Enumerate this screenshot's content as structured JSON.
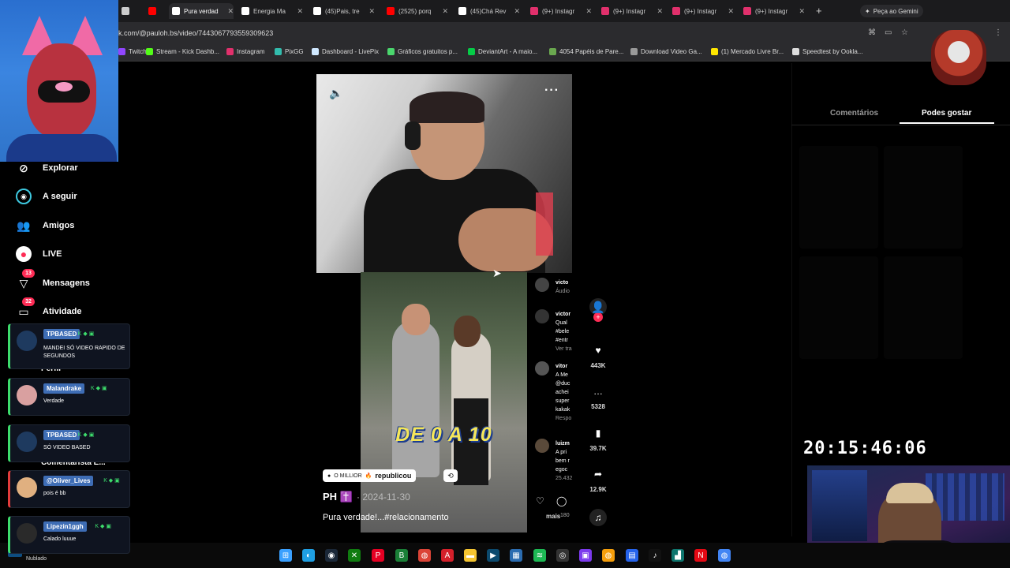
{
  "browser": {
    "tabs": [
      {
        "label": "",
        "color": "#cccccc",
        "active": false
      },
      {
        "label": "",
        "color": "#ff0000",
        "active": false
      },
      {
        "label": "Pura verdad",
        "color": "#ffffff",
        "active": true
      },
      {
        "label": "Energia Ma",
        "color": "#ffffff",
        "active": false
      },
      {
        "label": "(45)Pais, tre",
        "color": "#ffffff",
        "active": false
      },
      {
        "label": "(2525) porq",
        "color": "#ff0000",
        "active": false
      },
      {
        "label": "(45)Chá Rev",
        "color": "#ffffff",
        "active": false
      },
      {
        "label": "(9+) Instagr",
        "color": "#e1306c",
        "active": false
      },
      {
        "label": "(9+) Instagr",
        "color": "#e1306c",
        "active": false
      },
      {
        "label": "(9+) Instagr",
        "color": "#e1306c",
        "active": false
      },
      {
        "label": "(9+) Instagr",
        "color": "#e1306c",
        "active": false
      }
    ],
    "new_tab_glyph": "+",
    "gemini_label": "Peça ao Gemini",
    "url": "k.com/@pauloh.bs/video/7443067793559309623",
    "bookmarks": [
      {
        "label": "Twitch",
        "color": "#9146ff"
      },
      {
        "label": "Stream - Kick Dashb...",
        "color": "#53fc18"
      },
      {
        "label": "Instagram",
        "color": "#e1306c"
      },
      {
        "label": "PixGG",
        "color": "#32bcad"
      },
      {
        "label": "Dashboard - LivePix",
        "color": "#cfe8ff"
      },
      {
        "label": "Gráficos gratuitos p...",
        "color": "#4ad66d"
      },
      {
        "label": "DeviantArt - A maio...",
        "color": "#05cc47"
      },
      {
        "label": "4054 Papéis de Pare...",
        "color": "#6aa84f"
      },
      {
        "label": "Download Video Ga...",
        "color": "#999999"
      },
      {
        "label": "(1) Mercado Livre Br...",
        "color": "#ffe600"
      },
      {
        "label": "Speedtest by Ookla...",
        "color": "#dddddd"
      }
    ]
  },
  "nav": {
    "items": [
      {
        "label": "Explorar",
        "icon": "compass-icon",
        "glyph": "⊘"
      },
      {
        "label": "A seguir",
        "icon": "following-icon",
        "glyph": "◉"
      },
      {
        "label": "Amigos",
        "icon": "friends-icon",
        "glyph": "👥"
      },
      {
        "label": "LIVE",
        "icon": "live-icon",
        "glyph": "●"
      },
      {
        "label": "Mensagens",
        "icon": "messages-icon",
        "glyph": "▽",
        "badge": "13"
      },
      {
        "label": "Atividade",
        "icon": "activity-icon",
        "glyph": "▭",
        "badge": "32"
      }
    ]
  },
  "chat": [
    {
      "name": "TPBASED",
      "text": "MANDEI SÓ VIDEO RAPIDO DE SEGUNDOS",
      "accent": "#3ddc6c"
    },
    {
      "name": "Malandrake",
      "text": "Verdade",
      "accent": "#3ddc6c"
    },
    {
      "name": "TPBASED",
      "text": "SÓ VIDEO BASED",
      "accent": "#3ddc6c"
    },
    {
      "name": "@Oliver_Lives",
      "text": "pois é bb",
      "accent": "#e23b3b"
    },
    {
      "name": "Lipezin1ggh",
      "text": "Calado luuue",
      "accent": "#3ddc6c"
    }
  ],
  "chat_overlap": {
    "perfil": "Perfil",
    "comments": "Comentarista E..."
  },
  "clock": "20:15:46:06",
  "video": {
    "caption_overlay": "DE 0 A 10",
    "author": "PH ✝️",
    "date": "· 2024-11-30",
    "caption": "Pura verdade!...#relacionamento",
    "more": "mais",
    "repost_user": "O MILLIOR",
    "repost_label": "republicou",
    "comments": [
      {
        "lines": [
          "victo",
          "Áudio"
        ]
      },
      {
        "lines": [
          "victor",
          "Qual",
          "#bele",
          "#entr",
          "Ver tra"
        ]
      },
      {
        "lines": [
          "vitor",
          "A Me",
          "@duc",
          "achei",
          "super",
          "kakak",
          "Respo"
        ]
      },
      {
        "lines": [
          "luizm",
          "A pri",
          "bem r",
          "egoc",
          "25.432"
        ]
      }
    ],
    "small_count": "180"
  },
  "actions": [
    {
      "name": "like",
      "icon": "heart-icon",
      "glyph": "♥",
      "count": "443K"
    },
    {
      "name": "comment",
      "icon": "comment-icon",
      "glyph": "…",
      "count": "5328"
    },
    {
      "name": "save",
      "icon": "bookmark-icon",
      "glyph": "▮",
      "count": "39.7K"
    },
    {
      "name": "share",
      "icon": "share-icon",
      "glyph": "➦",
      "count": "12.9K"
    }
  ],
  "right_panel": {
    "tab_comments": "Comentários",
    "tab_liked": "Podes gostar"
  },
  "taskbar": {
    "weather": "Nublado",
    "apps": [
      {
        "icon": "windows-icon",
        "glyph": "⊞",
        "color": "#3aa0ff"
      },
      {
        "icon": "edge-icon",
        "glyph": "◐",
        "color": "#1f9fe3"
      },
      {
        "icon": "steam-icon",
        "glyph": "◉",
        "color": "#1b2838"
      },
      {
        "icon": "xbox-icon",
        "glyph": "✕",
        "color": "#107c10"
      },
      {
        "icon": "pinterest-icon",
        "glyph": "P",
        "color": "#e60023"
      },
      {
        "icon": "app-b-icon",
        "glyph": "B",
        "color": "#1a7f37"
      },
      {
        "icon": "chrome-icon",
        "glyph": "◍",
        "color": "#db4437"
      },
      {
        "icon": "adobe-icon",
        "glyph": "A",
        "color": "#d4202a"
      },
      {
        "icon": "folder-icon",
        "glyph": "▬",
        "color": "#f4c430"
      },
      {
        "icon": "terminal-icon",
        "glyph": "▶",
        "color": "#0c4a6e"
      },
      {
        "icon": "calculator-icon",
        "glyph": "▦",
        "color": "#2b6cb0"
      },
      {
        "icon": "spotify-icon",
        "glyph": "≋",
        "color": "#1db954"
      },
      {
        "icon": "obs-icon",
        "glyph": "◎",
        "color": "#333333"
      },
      {
        "icon": "app-grid-icon",
        "glyph": "▣",
        "color": "#7c3aed"
      },
      {
        "icon": "chrome-alt-icon",
        "glyph": "◍",
        "color": "#f59e0b"
      },
      {
        "icon": "calendar-icon",
        "glyph": "▤",
        "color": "#2563eb"
      },
      {
        "icon": "tiktok-icon",
        "glyph": "♪",
        "color": "#111111"
      },
      {
        "icon": "app-teal-icon",
        "glyph": "▟",
        "color": "#0f766e"
      },
      {
        "icon": "netflix-icon",
        "glyph": "N",
        "color": "#e50914"
      },
      {
        "icon": "chrome-active-icon",
        "glyph": "◍",
        "color": "#4285f4"
      }
    ]
  }
}
